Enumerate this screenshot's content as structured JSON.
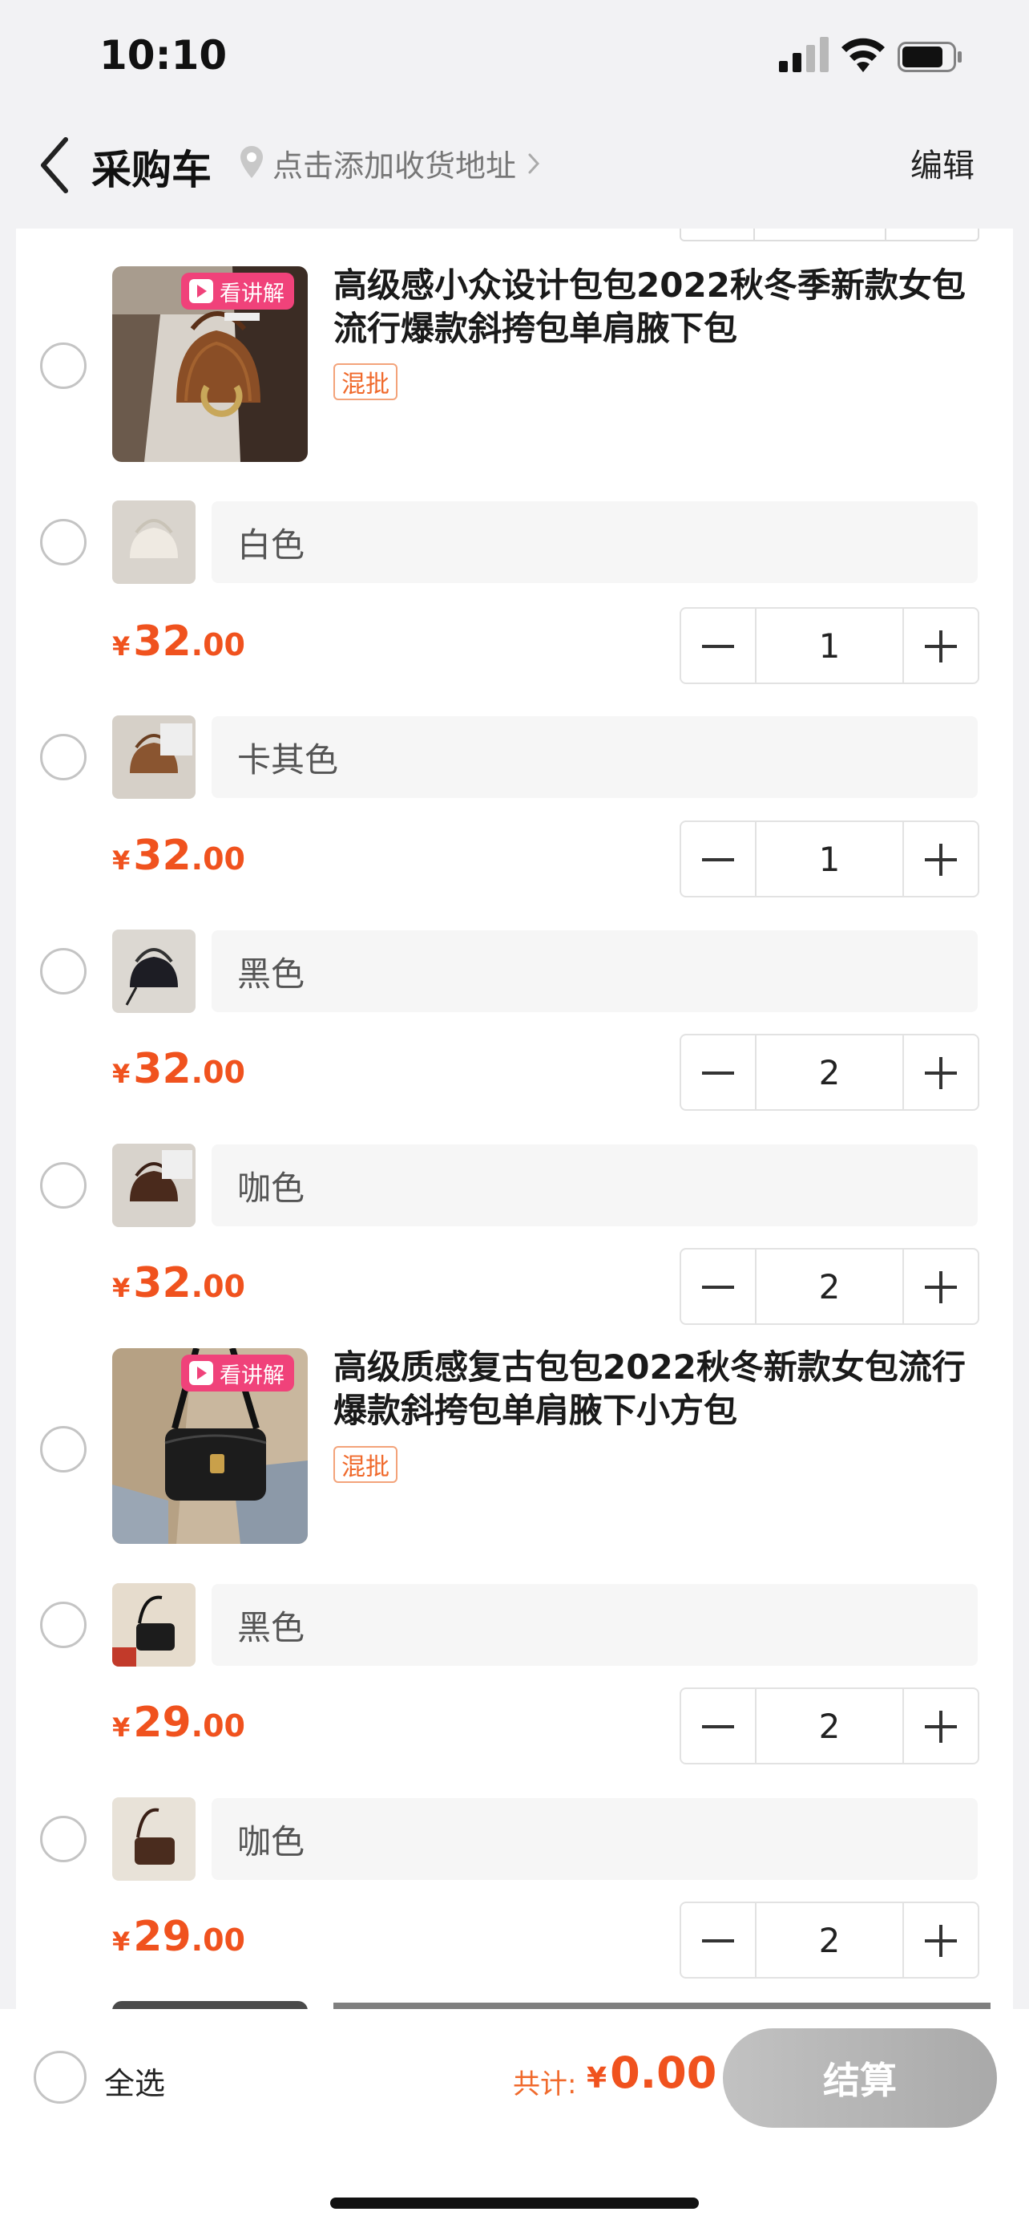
{
  "status_bar": {
    "time": "10:10"
  },
  "nav": {
    "title": "采购车",
    "address": "点击添加收货地址",
    "edit": "编辑"
  },
  "products": [
    {
      "badge": "看讲解",
      "title": "高级感小众设计包包2022秋冬季新款女包流行爆款斜挎包单肩腋下包",
      "tag": "混批",
      "variants": [
        {
          "name": "白色",
          "currency": "¥",
          "price_int": "32",
          "price_dec": ".00",
          "qty": "1"
        },
        {
          "name": "卡其色",
          "currency": "¥",
          "price_int": "32",
          "price_dec": ".00",
          "qty": "1"
        },
        {
          "name": "黑色",
          "currency": "¥",
          "price_int": "32",
          "price_dec": ".00",
          "qty": "2"
        },
        {
          "name": "咖色",
          "currency": "¥",
          "price_int": "32",
          "price_dec": ".00",
          "qty": "2"
        }
      ]
    },
    {
      "badge": "看讲解",
      "title": "高级质感复古包包2022秋冬新款女包流行爆款斜挎包单肩腋下小方包",
      "tag": "混批",
      "variants": [
        {
          "name": "黑色",
          "currency": "¥",
          "price_int": "29",
          "price_dec": ".00",
          "qty": "2"
        },
        {
          "name": "咖色",
          "currency": "¥",
          "price_int": "29",
          "price_dec": ".00",
          "qty": "2"
        }
      ]
    }
  ],
  "bottom_bar": {
    "select_all": "全选",
    "total_label": "共计:",
    "currency": "¥",
    "total_amount": "0.00",
    "checkout": "结算"
  },
  "colors": {
    "price": "#f0521e",
    "live_badge": "#f0427a",
    "checkout_disabled": "#b5b5b5"
  }
}
